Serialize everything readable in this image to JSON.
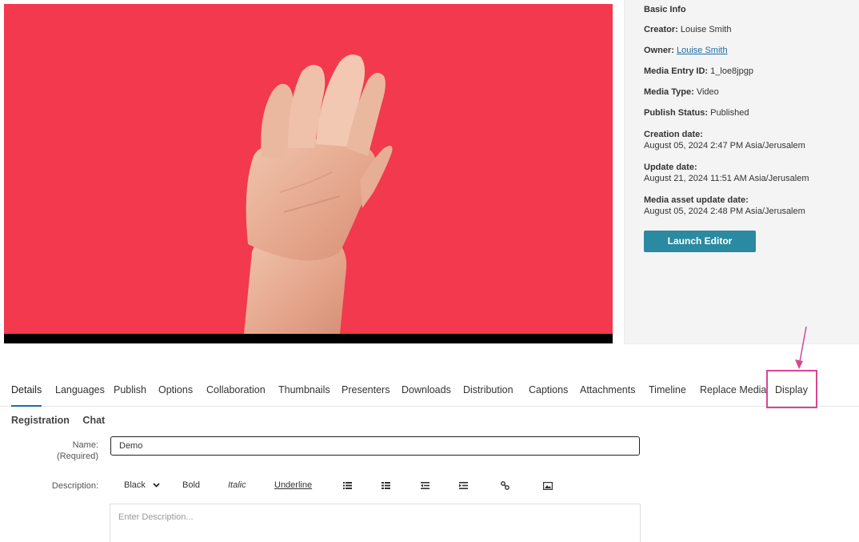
{
  "player": {
    "background_color": "#f2394d"
  },
  "info": {
    "heading": "Basic Info",
    "creator_label": "Creator:",
    "creator_value": "Louise Smith",
    "owner_label": "Owner:",
    "owner_value": "Louise Smith",
    "entry_id_label": "Media Entry ID:",
    "entry_id_value": "1_loe8jpgp",
    "media_type_label": "Media Type:",
    "media_type_value": "Video",
    "publish_status_label": "Publish Status:",
    "publish_status_value": "Published",
    "creation_date_label": "Creation date:",
    "creation_date_value": "August 05, 2024 2:47 PM Asia/Jerusalem",
    "update_date_label": "Update date:",
    "update_date_value": "August 21, 2024 11:51 AM Asia/Jerusalem",
    "asset_update_label": "Media asset update date:",
    "asset_update_value": "August 05, 2024 2:48 PM Asia/Jerusalem",
    "launch_button": "Launch Editor"
  },
  "tabs": [
    "Details",
    "Languages",
    "Publish",
    "Options",
    "Collaboration",
    "Thumbnails",
    "Presenters",
    "Downloads",
    "Distribution",
    "Captions",
    "Attachments",
    "Timeline",
    "Replace Media",
    "Display"
  ],
  "active_tab": "Details",
  "subtabs": [
    "Registration",
    "Chat"
  ],
  "form": {
    "name_label": "Name:",
    "name_required": "(Required)",
    "name_value": "Demo",
    "description_label": "Description:",
    "description_placeholder": "Enter Description...",
    "toolbar": {
      "color": "Black",
      "bold": "Bold",
      "italic": "Italic",
      "underline": "Underline"
    }
  },
  "colors": {
    "accent": "#2a8aa1",
    "highlight_box": "#d64697",
    "link": "#1b6ea8"
  }
}
